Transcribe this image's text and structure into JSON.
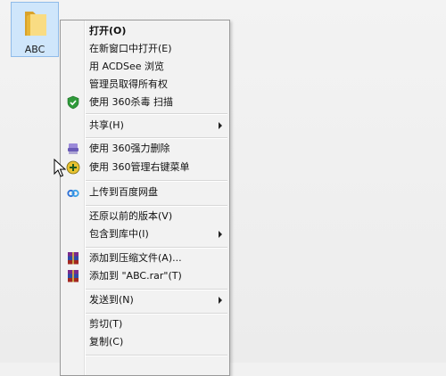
{
  "desktop": {
    "folder": {
      "label": "ABC",
      "selected": true,
      "color": "#e8b637"
    }
  },
  "menu": {
    "items": [
      {
        "label": "打开(O)",
        "bold": true
      },
      {
        "label": "在新窗口中打开(E)"
      },
      {
        "label": "用 ACDSee 浏览"
      },
      {
        "label": "管理员取得所有权"
      },
      {
        "label": "使用 360杀毒 扫描",
        "icon": "shield-icon"
      },
      {
        "label": "共享(H)",
        "submenu": true
      },
      {
        "label": "使用 360强力删除",
        "icon": "shredder-icon"
      },
      {
        "label": "使用 360管理右键菜单",
        "icon": "plus-circle-icon"
      },
      {
        "label": "上传到百度网盘",
        "icon": "baidu-cloud-icon"
      },
      {
        "label": "还原以前的版本(V)"
      },
      {
        "label": "包含到库中(I)",
        "submenu": true
      },
      {
        "label": "添加到压缩文件(A)...",
        "icon": "winrar-icon"
      },
      {
        "label": "添加到 \"ABC.rar\"(T)",
        "icon": "winrar-icon"
      },
      {
        "label": "发送到(N)",
        "submenu": true
      },
      {
        "label": "剪切(T)"
      },
      {
        "label": "复制(C)"
      }
    ]
  }
}
